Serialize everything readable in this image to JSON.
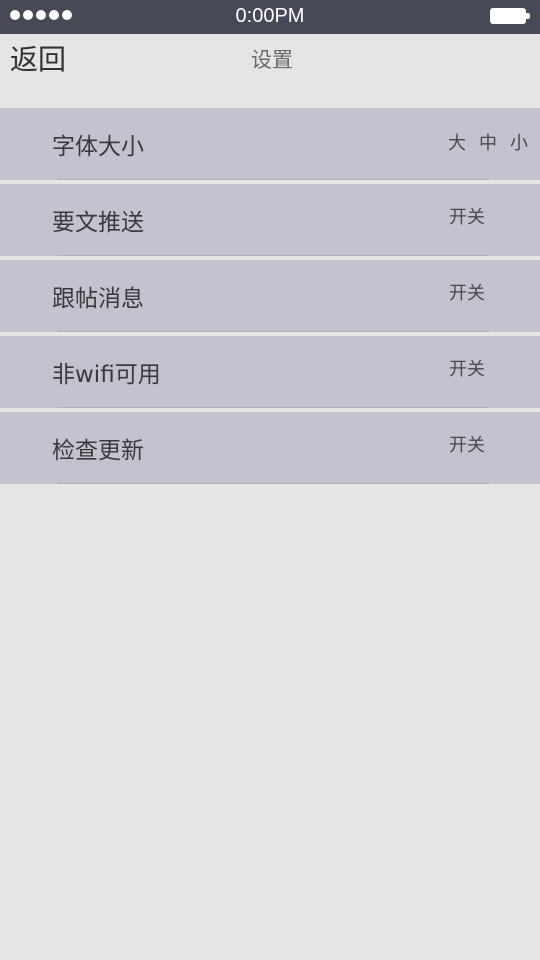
{
  "status_bar": {
    "time": "0:00PM",
    "signal_dots": 5
  },
  "nav": {
    "back_label": "返回",
    "title": "设置"
  },
  "settings": {
    "font_size": {
      "label": "字体大小",
      "options": [
        "大",
        "中",
        "小"
      ]
    },
    "items": [
      {
        "label": "要文推送",
        "toggle": "开关"
      },
      {
        "label": "跟帖消息",
        "toggle": "开关"
      },
      {
        "label": "非wifi可用",
        "toggle": "开关"
      },
      {
        "label": "检查更新",
        "toggle": "开关"
      }
    ]
  },
  "colors": {
    "status_bar_bg": "#474a56",
    "page_bg": "#e5e5e5",
    "row_bg": "#c3c3d0"
  }
}
